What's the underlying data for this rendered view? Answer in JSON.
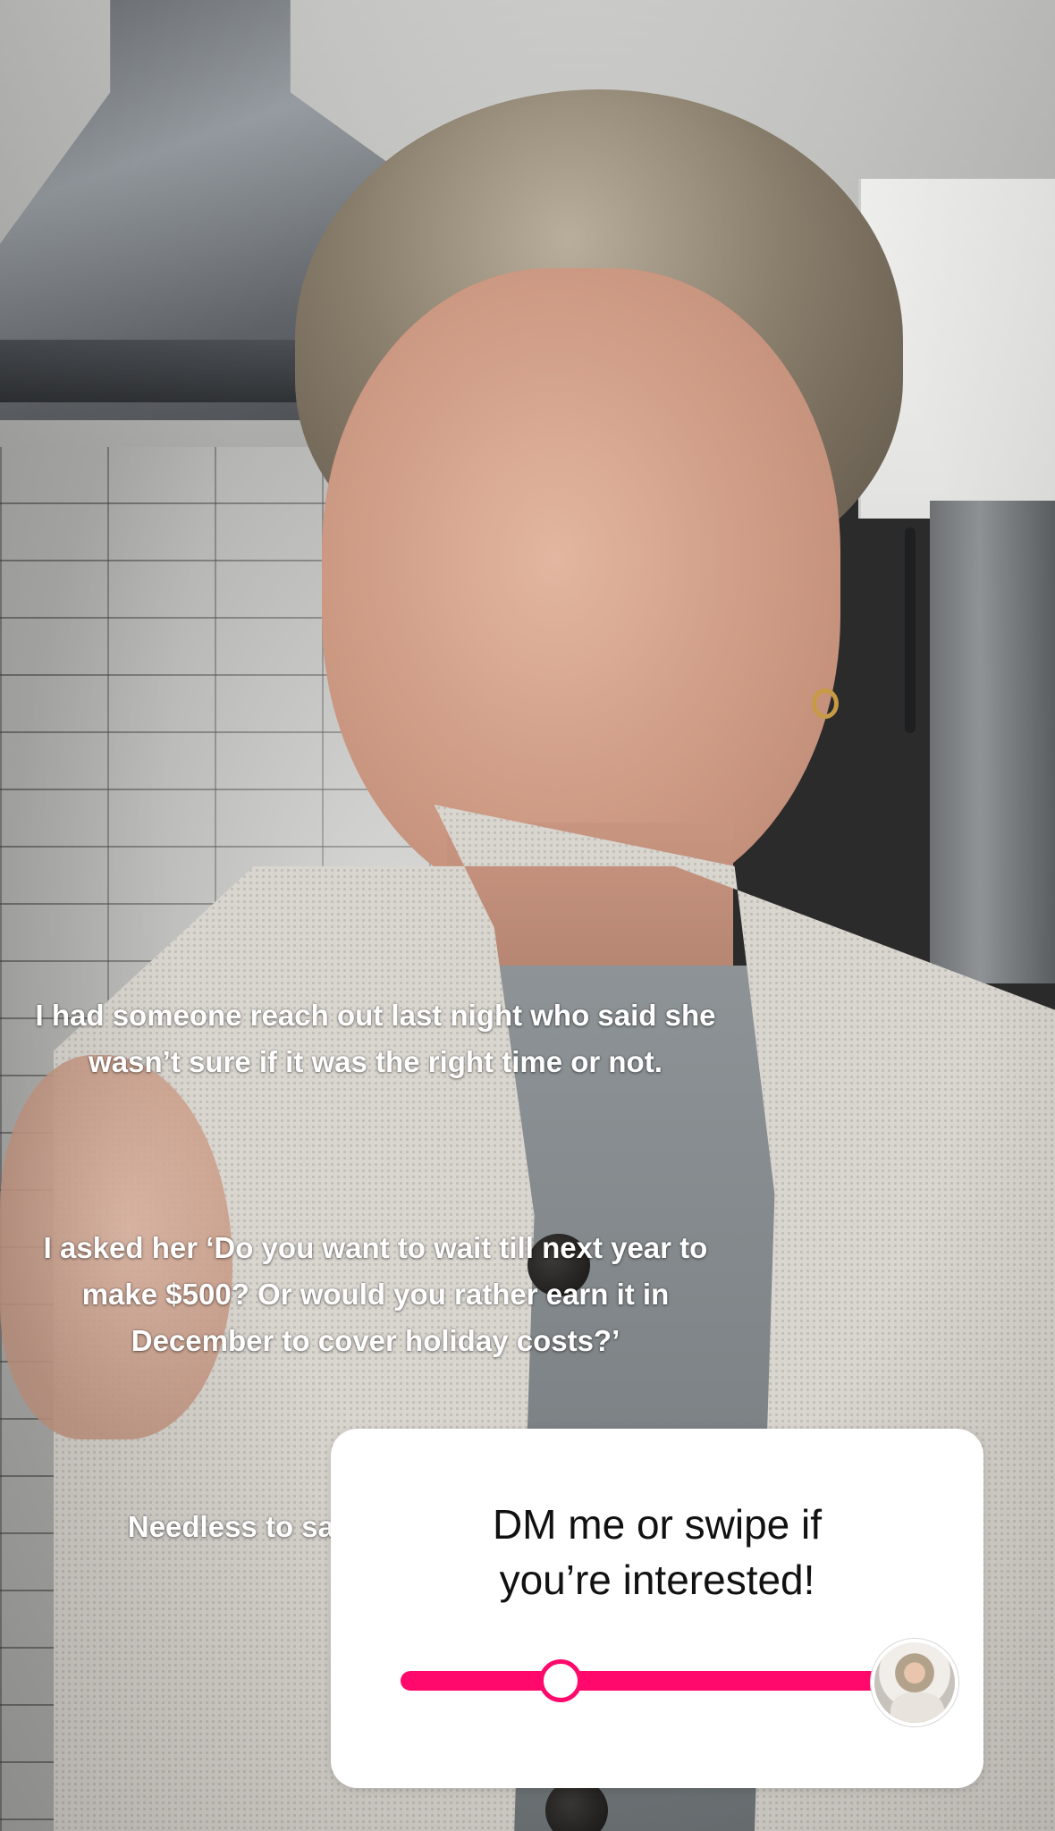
{
  "story": {
    "caption": {
      "paragraph_1": "I had someone reach out last night who said she wasn’t sure if it was the right time or not.",
      "paragraph_2": "I asked her ‘Do you want to wait till next year to make $500? Or would you rather earn it in December to cover holiday costs?’",
      "paragraph_3": "Needless to say she joined 🥰🥰🥰"
    },
    "slider_sticker": {
      "question": "DM me or swipe if you’re interested!",
      "value_fraction": 0.32,
      "track_color": "#ff0a6c",
      "handle_icon": "slider-handle",
      "avatar_icon": "profile-avatar"
    }
  }
}
